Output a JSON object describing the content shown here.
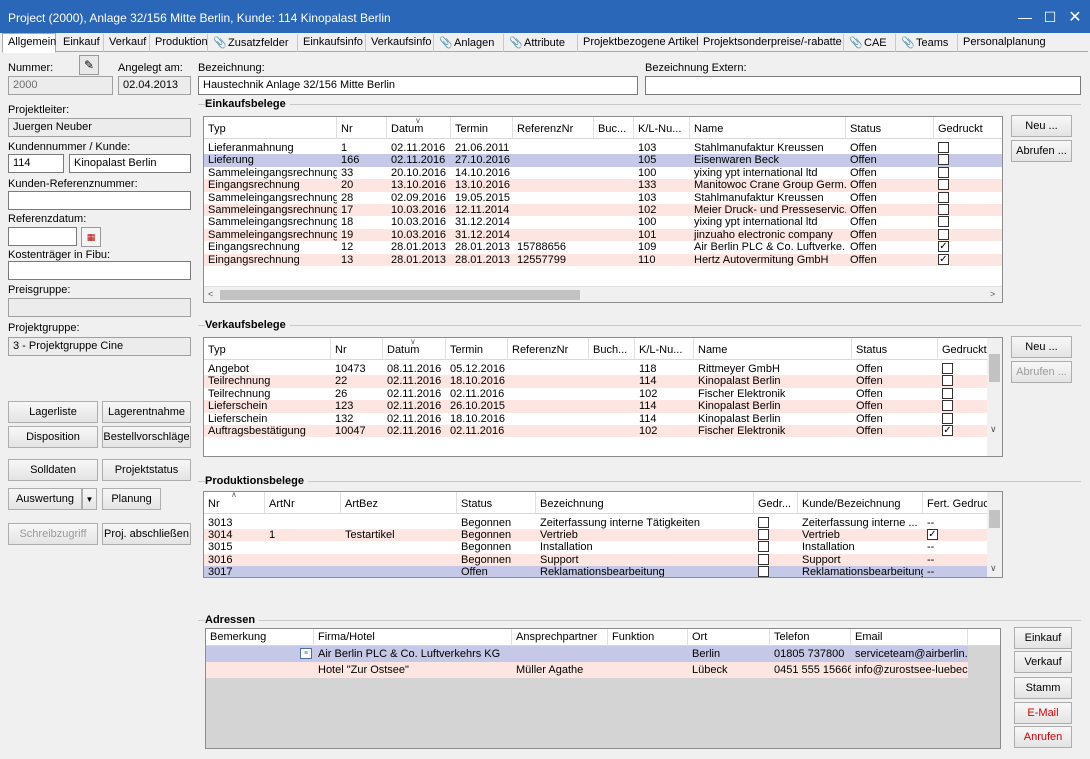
{
  "window": {
    "title": "Project (2000), Anlage 32/156 Mitte Berlin, Kunde: 114 Kinopalast Berlin"
  },
  "tabs": [
    "Allgemein",
    "Einkauf",
    "Verkauf",
    "Produktion",
    "Zusatzfelder",
    "Einkaufsinfo",
    "Verkaufsinfo",
    "Anlagen",
    "Attribute",
    "Projektbezogene Artikel",
    "Projektsonderpreise/-rabatte",
    "CAE",
    "Teams",
    "Personalplanung"
  ],
  "header": {
    "nummer_label": "Nummer:",
    "nummer_value": "2000",
    "angelegt_label": "Angelegt am:",
    "angelegt_value": "02.04.2013",
    "bezeichnung_label": "Bezeichnung:",
    "bezeichnung_value": "Haustechnik Anlage 32/156 Mitte Berlin",
    "bez_extern_label": "Bezeichnung Extern:",
    "bez_extern_value": ""
  },
  "left": {
    "projektleiter_label": "Projektleiter:",
    "projektleiter_value": "Juergen Neuber",
    "kunde_label": "Kundennummer / Kunde:",
    "kunde_nr": "114",
    "kunde_name": "Kinopalast Berlin",
    "kundenref_label": "Kunden-Referenznummer:",
    "kundenref_value": "",
    "refdatum_label": "Referenzdatum:",
    "refdatum_value": "",
    "kostentraeger_label": "Kostenträger in Fibu:",
    "kostentraeger_value": "",
    "preisgruppe_label": "Preisgruppe:",
    "preisgruppe_value": "",
    "projektgruppe_label": "Projektgruppe:",
    "projektgruppe_value": "3 - Projektgruppe Cine",
    "buttons": {
      "lagerliste": "Lagerliste",
      "lagerentnahme": "Lagerentnahme",
      "disposition": "Disposition",
      "bestellvorschlaege": "Bestellvorschläge",
      "solldaten": "Solldaten",
      "projektstatus": "Projektstatus",
      "auswertung": "Auswertung",
      "planung": "Planung",
      "schreibzugriff": "Schreibzugriff",
      "abschliessen": "Proj. abschließen"
    }
  },
  "einkauf": {
    "title": "Einkaufsbelege",
    "columns": [
      "Typ",
      "Nr",
      "Datum",
      "Termin",
      "ReferenzNr",
      "Buc...",
      "K/L-Nu...",
      "Name",
      "Status",
      "Gedruckt"
    ],
    "rows": [
      [
        "Lieferanmahnung",
        "1",
        "02.11.2016",
        "21.06.2011",
        "",
        "",
        "103",
        "Stahlmanufaktur Kreussen",
        "Offen",
        false
      ],
      [
        "Lieferung",
        "166",
        "02.11.2016",
        "27.10.2016",
        "",
        "",
        "105",
        "Eisenwaren Beck",
        "Offen",
        false
      ],
      [
        "Sammeleingangsrechnung",
        "33",
        "20.10.2016",
        "14.10.2016",
        "",
        "",
        "100",
        "yixing ypt international ltd",
        "Offen",
        false
      ],
      [
        "Eingangsrechnung",
        "20",
        "13.10.2016",
        "13.10.2016",
        "",
        "",
        "133",
        "Manitowoc Crane Group Germ...",
        "Offen",
        false
      ],
      [
        "Sammeleingangsrechnung",
        "28",
        "02.09.2016",
        "19.05.2015",
        "",
        "",
        "103",
        "Stahlmanufaktur Kreussen",
        "Offen",
        false
      ],
      [
        "Sammeleingangsrechnung",
        "17",
        "10.03.2016",
        "12.11.2014",
        "",
        "",
        "102",
        "Meier Druck- und Presseservic...",
        "Offen",
        false
      ],
      [
        "Sammeleingangsrechnung",
        "18",
        "10.03.2016",
        "31.12.2014",
        "",
        "",
        "100",
        "yixing ypt international ltd",
        "Offen",
        false
      ],
      [
        "Sammeleingangsrechnung",
        "19",
        "10.03.2016",
        "31.12.2014",
        "",
        "",
        "101",
        "jinzuaho electronic company",
        "Offen",
        false
      ],
      [
        "Eingangsrechnung",
        "12",
        "28.01.2013",
        "28.01.2013",
        "15788656",
        "",
        "109",
        "Air Berlin PLC & Co. Luftverke...",
        "Offen",
        true
      ],
      [
        "Eingangsrechnung",
        "13",
        "28.01.2013",
        "28.01.2013",
        "12557799",
        "",
        "110",
        "Hertz Autovermitung GmbH",
        "Offen",
        true
      ]
    ],
    "btn_neu": "Neu ...",
    "btn_abrufen": "Abrufen ..."
  },
  "verkauf": {
    "title": "Verkaufsbelege",
    "columns": [
      "Typ",
      "Nr",
      "Datum",
      "Termin",
      "ReferenzNr",
      "Buch...",
      "K/L-Nu...",
      "Name",
      "Status",
      "Gedruckt"
    ],
    "rows": [
      [
        "Angebot",
        "10473",
        "08.11.2016",
        "05.12.2016",
        "",
        "",
        "118",
        "Rittmeyer GmbH",
        "Offen",
        false
      ],
      [
        "Teilrechnung",
        "22",
        "02.11.2016",
        "18.10.2016",
        "",
        "",
        "114",
        "Kinopalast Berlin",
        "Offen",
        false
      ],
      [
        "Teilrechnung",
        "26",
        "02.11.2016",
        "02.11.2016",
        "",
        "",
        "102",
        "Fischer Elektronik",
        "Offen",
        false
      ],
      [
        "Lieferschein",
        "123",
        "02.11.2016",
        "26.10.2015",
        "",
        "",
        "114",
        "Kinopalast Berlin",
        "Offen",
        false
      ],
      [
        "Lieferschein",
        "132",
        "02.11.2016",
        "18.10.2016",
        "",
        "",
        "114",
        "Kinopalast Berlin",
        "Offen",
        false
      ],
      [
        "Auftragsbestätigung",
        "10047",
        "02.11.2016",
        "02.11.2016",
        "",
        "",
        "102",
        "Fischer Elektronik",
        "Offen",
        true
      ]
    ],
    "btn_neu": "Neu ...",
    "btn_abrufen": "Abrufen ..."
  },
  "produktion": {
    "title": "Produktionsbelege",
    "columns": [
      "Nr",
      "ArtNr",
      "ArtBez",
      "Status",
      "Bezeichnung",
      "Gedr...",
      "Kunde/Bezeichnung",
      "Fert. Gedruckt"
    ],
    "rows": [
      [
        "3013",
        "",
        "",
        "Begonnen",
        "Zeiterfassung interne Tätigkeiten",
        false,
        "Zeiterfassung interne ...",
        "--"
      ],
      [
        "3014",
        "1",
        "Testartikel",
        "Begonnen",
        "Vertrieb",
        false,
        "Vertrieb",
        true
      ],
      [
        "3015",
        "",
        "",
        "Begonnen",
        "Installation",
        false,
        "Installation",
        "--"
      ],
      [
        "3016",
        "",
        "",
        "Begonnen",
        "Support",
        false,
        "Support",
        "--"
      ],
      [
        "3017",
        "",
        "",
        "Offen",
        "Reklamationsbearbeitung",
        false,
        "Reklamationsbearbeitung",
        "--"
      ]
    ]
  },
  "adressen": {
    "title": "Adressen",
    "columns": [
      "Bemerkung",
      "Firma/Hotel",
      "Ansprechpartner",
      "Funktion",
      "Ort",
      "Telefon",
      "Email"
    ],
    "rows": [
      [
        "",
        "Air Berlin PLC & Co. Luftverkehrs KG",
        "",
        "",
        "Berlin",
        "01805 737800",
        "serviceteam@airberlin.c"
      ],
      [
        "",
        "Hotel \"Zur Ostsee\"",
        "Müller Agathe",
        "",
        "Lübeck",
        "0451 555 15666",
        "info@zurostsee-luebeck"
      ]
    ],
    "buttons": {
      "einkauf": "Einkauf",
      "verkauf": "Verkauf",
      "stamm": "Stamm",
      "email": "E-Mail",
      "anrufen": "Anrufen"
    }
  }
}
